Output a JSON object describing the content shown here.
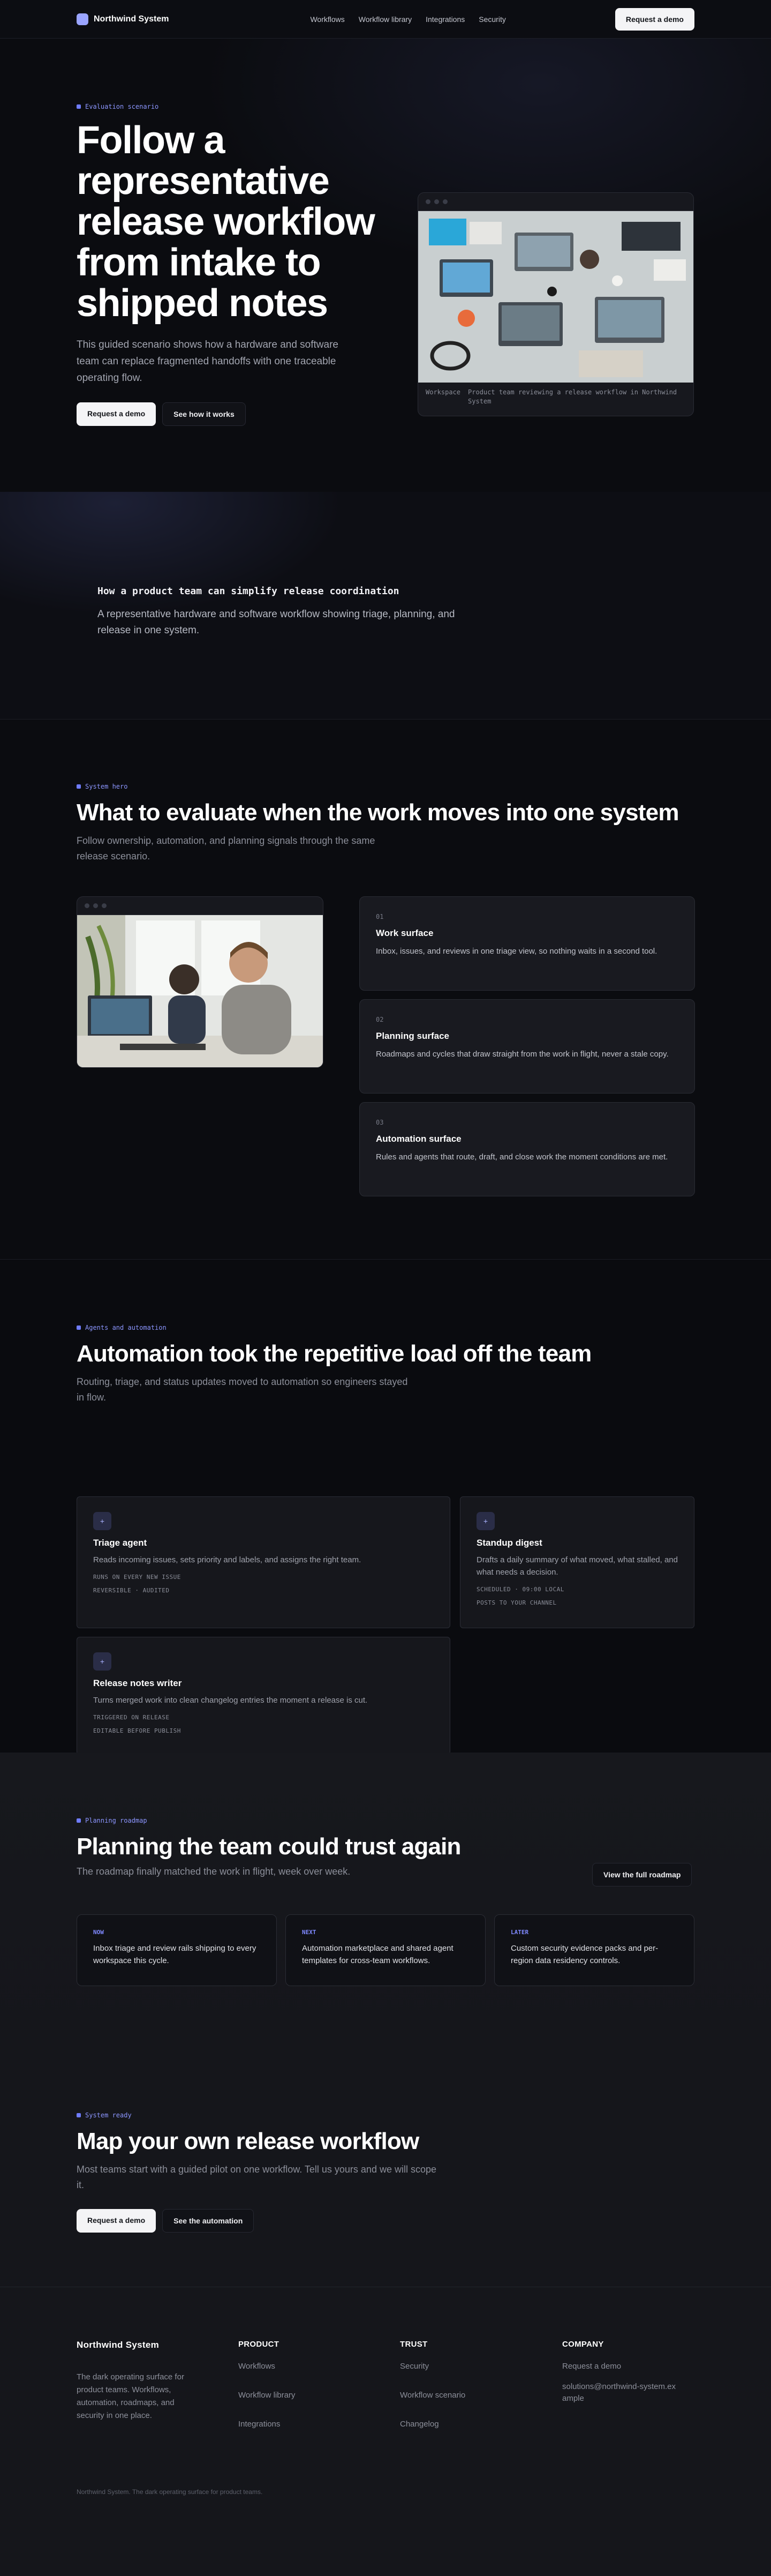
{
  "nav": {
    "brand": "Northwind System",
    "links": [
      "Workflows",
      "Workflow library",
      "Integrations",
      "Security"
    ],
    "cta": "Request a demo"
  },
  "hero": {
    "eyebrow": "Evaluation scenario",
    "title": "Follow a representative release workflow from intake to shipped notes",
    "subtitle": "This guided scenario shows how a hardware and software team can replace fragmented handoffs with one traceable operating flow.",
    "primary_cta": "Request a demo",
    "secondary_cta": "See how it works",
    "image_caption_label": "Workspace",
    "image_caption": "Product team reviewing a release workflow in Northwind System"
  },
  "intro": {
    "heading": "How a product team can simplify release coordination",
    "text": "A representative hardware and software workflow showing triage, planning, and release in one system."
  },
  "system_hero": {
    "eyebrow": "System hero",
    "title": "What to evaluate when the work moves into one system",
    "subtitle": "Follow ownership, automation, and planning signals through the same release scenario.",
    "surfaces": [
      {
        "num": "01",
        "title": "Work surface",
        "text": "Inbox, issues, and reviews in one triage view, so nothing waits in a second tool."
      },
      {
        "num": "02",
        "title": "Planning surface",
        "text": "Roadmaps and cycles that draw straight from the work in flight, never a stale copy."
      },
      {
        "num": "03",
        "title": "Automation surface",
        "text": "Rules and agents that route, draft, and close work the moment conditions are met."
      }
    ]
  },
  "automation": {
    "eyebrow": "Agents and automation",
    "title": "Automation took the repetitive load off the team",
    "subtitle": "Routing, triage, and status updates moved to automation so engineers stayed in flow.",
    "agents": [
      {
        "icon": "+",
        "title": "Triage agent",
        "text": "Reads incoming issues, sets priority and labels, and assigns the right team.",
        "meta1": "RUNS ON EVERY NEW ISSUE",
        "meta2": "REVERSIBLE · AUDITED"
      },
      {
        "icon": "+",
        "title": "Standup digest",
        "text": "Drafts a daily summary of what moved, what stalled, and what needs a decision.",
        "meta1": "SCHEDULED · 09:00 LOCAL",
        "meta2": "POSTS TO YOUR CHANNEL"
      },
      {
        "icon": "+",
        "title": "Release notes writer",
        "text": "Turns merged work into clean changelog entries the moment a release is cut.",
        "meta1": "TRIGGERED ON RELEASE",
        "meta2": "EDITABLE BEFORE PUBLISH"
      }
    ]
  },
  "roadmap": {
    "eyebrow": "Planning roadmap",
    "title": "Planning the team could trust again",
    "subtitle": "The roadmap finally matched the work in flight, week over week.",
    "cta": "View the full roadmap",
    "items": [
      {
        "tag": "NOW",
        "text": "Inbox triage and review rails shipping to every workspace this cycle."
      },
      {
        "tag": "NEXT",
        "text": "Automation marketplace and shared agent templates for cross-team workflows."
      },
      {
        "tag": "LATER",
        "text": "Custom security evidence packs and per-region data residency controls."
      }
    ]
  },
  "cta": {
    "eyebrow": "System ready",
    "title": "Map your own release workflow",
    "subtitle": "Most teams start with a guided pilot on one workflow. Tell us yours and we will scope it.",
    "primary": "Request a demo",
    "secondary": "See the automation"
  },
  "footer": {
    "brand": "Northwind System",
    "description": "The dark operating surface for product teams. Workflows, automation, roadmaps, and security in one place.",
    "columns": [
      {
        "title": "PRODUCT",
        "links": [
          "Workflows",
          "Workflow library",
          "Integrations"
        ]
      },
      {
        "title": "TRUST",
        "links": [
          "Security",
          "Workflow scenario",
          "Changelog"
        ]
      },
      {
        "title": "COMPANY",
        "links": [
          "Request a demo",
          "solutions@northwind-system.example"
        ]
      }
    ],
    "bottom": "Northwind System. The dark operating surface for product teams."
  },
  "colors": {
    "accent": "#8c96ff",
    "background": "#0b0c10",
    "card": "#191a20"
  }
}
